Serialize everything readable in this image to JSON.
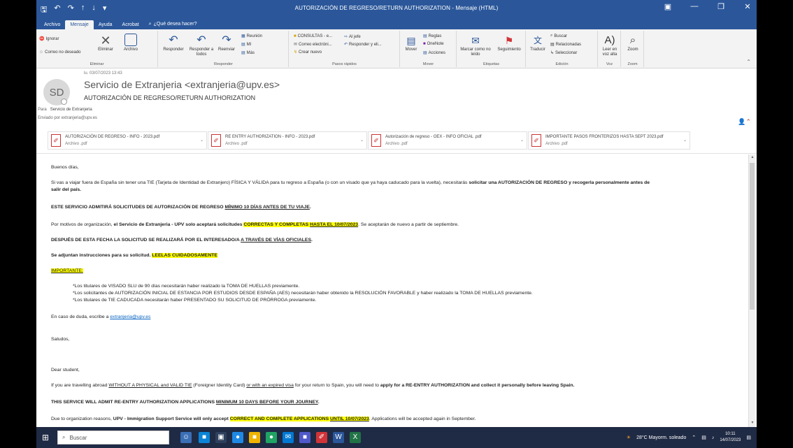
{
  "window": {
    "title": "AUTORIZACIÓN DE REGRESO/RETURN AUTHORIZATION  -  Mensaje (HTML)"
  },
  "tabs": [
    {
      "label": "Archivo"
    },
    {
      "label": "Mensaje"
    },
    {
      "label": "Ayuda"
    },
    {
      "label": "Acrobat"
    },
    {
      "label": "¿Qué desea hacer?"
    }
  ],
  "ribbon": {
    "ignore": "Ignorar",
    "junk": "Correo no deseado",
    "delete": "Eliminar",
    "archive": "Archivo",
    "group_delete": "Eliminar",
    "reply": "Responder",
    "reply_all": "Responder a todos",
    "forward": "Reenviar",
    "meeting": "Reunión",
    "im": "MI",
    "more": "Más",
    "group_respond": "Responder",
    "qs1": "CONSULTAS - e...",
    "qs2": "Correo electróni...",
    "qs3": "Crear nuevo",
    "qs4": "Al jefe",
    "qs5": "Responder y eli...",
    "group_quicksteps": "Pasos rápidos",
    "move": "Mover",
    "rules": "Reglas",
    "onenote": "OneNote",
    "actions": "Acciones",
    "group_move": "Mover",
    "mark_unread": "Marcar como no leído",
    "followup": "Seguimiento",
    "group_tags": "Etiquetas",
    "translate": "Traducir",
    "find": "Buscar",
    "related": "Relacionadas",
    "select": "Seleccionar",
    "group_edit": "Edición",
    "read_aloud": "Leer en voz alta",
    "group_voice": "Voz",
    "zoom": "Zoom",
    "group_zoom": "Zoom"
  },
  "header": {
    "date": "lu. 03/07/2023 13:43",
    "initials": "SD",
    "sender": "Servicio de Extranjeria <extranjeria@upv.es>",
    "subject": "AUTORIZACIÓN DE REGRESO/RETURN AUTHORIZATION",
    "to_label": "Para",
    "to_value": "Servicio de Extranjeria",
    "sent_by": "Enviado por  extranjeria@upv.es"
  },
  "attachments": [
    {
      "name": "AUTORIZACIÓN DE REGRESO - INFO - 2023.pdf",
      "kind": "Archivo .pdf"
    },
    {
      "name": "RE ENTRY AUTHORIZATION - INFO - 2023.pdf",
      "kind": "Archivo .pdf"
    },
    {
      "name": "Autorización de regreso - OEX - INFO OFICIAL .pdf",
      "kind": "Archivo .pdf"
    },
    {
      "name": "IMPORTANTE PASOS FRONTERIZOS HASTA SEPT 2023.pdf",
      "kind": "Archivo .pdf"
    }
  ],
  "body": {
    "greeting": "Buenos días,",
    "p1a": "Si vas a viajar fuera de España sin tener una TIE (Tarjeta de Identidad de Extranjero) FÍSICA Y VÁLIDA para tu regreso a España (o con un visado que ya haya caducado para la vuelta), necesitarás ",
    "p1b": "solicitar una AUTORIZACIÓN DE REGRESO y recogerla personalmente antes de",
    "p1c": "salir del país.",
    "p2a": "ESTE SERVICIO ADMITIRÁ SOLICITUDES DE AUTORIZACIÓN DE REGRESO ",
    "p2b": "MÍNIMO 10 DÍAS ANTES DE TU VIAJE",
    "p2c": ".",
    "p3a": "Por motivos de organización, ",
    "p3b": "el Servicio de Extranjeria - UPV solo aceptará solicitudes ",
    "p3c": "CORRECTAS Y COMPLETAS ",
    "p3d": "HASTA EL 10/07/2023",
    "p3e": ". Se aceptarán de nuevo a partir de septiembre.",
    "p4a": "DESPUÉS DE ESTA FECHA LA SOLICITUD SE REALIZARÁ POR EL INTERESADO/A ",
    "p4b": "A TRAVÉS DE VÍAS OFICIALES",
    "p4c": ".",
    "p5a": "Se adjuntan instrucciones para su solicitud. ",
    "p5b": "LEELAS CUIDADOSAMENTE",
    "important": "IMPORTANTE:",
    "b1": "*Los titulares de VISADO SLU de 90 días necesitarán haber realizado la TOMA DE HUELLAS previamente.",
    "b2": "*Los solicitantes de AUTORIZACIÓN INICIAL DE ESTANCIA POR ESTUDIOS DESDE ESPAÑA (AES) necesitarán haber obtenido la RESOLUCIÓN FAVORABLE y haber realizado la TOMA DE HUELLAS previamente.",
    "b3": "*Los titulares de TIE CADUCADA necesitarán haber PRESENTADO SU SOLICITUD DE PRÓRROGA previamente.",
    "doubt": "En caso de duda, escribe a ",
    "doubt_link": "extranjeria@upv.es",
    "bye": "Saludos,",
    "en_greeting": "Dear student,",
    "e1a": "If you are travelling abroad ",
    "e1b": "WITHOUT A PHYSICAL and VALID TIE",
    "e1c": " (Foreigner Identity Card) ",
    "e1d": "or with an expired visa",
    "e1e": " for your return to Spain, you will need to ",
    "e1f": "apply for a RE-ENTRY AUTHORIZATION and collect it personally before leaving Spain.",
    "e2a": "THIS SERVICE WILL ADMIT RE-ENTRY AUTHORIZATION APPLICATIONS ",
    "e2b": "MINIMUM 10 DAYS BEFORE YOUR JOURNEY",
    "e2c": ".",
    "e3a": "Due to organization reasons, ",
    "e3b": "UPV -  Immigration Support Service will only accept ",
    "e3c": "CORRECT AND COMPLETE APPLICATIONS ",
    "e3d": "UNTIL 10/07/2023",
    "e3e": ". Applications will be accepted again in September."
  },
  "taskbar": {
    "search_placeholder": "Buscar",
    "weather": "28°C  Mayorm. soleado",
    "time": "10:11",
    "date": "14/07/2023"
  }
}
